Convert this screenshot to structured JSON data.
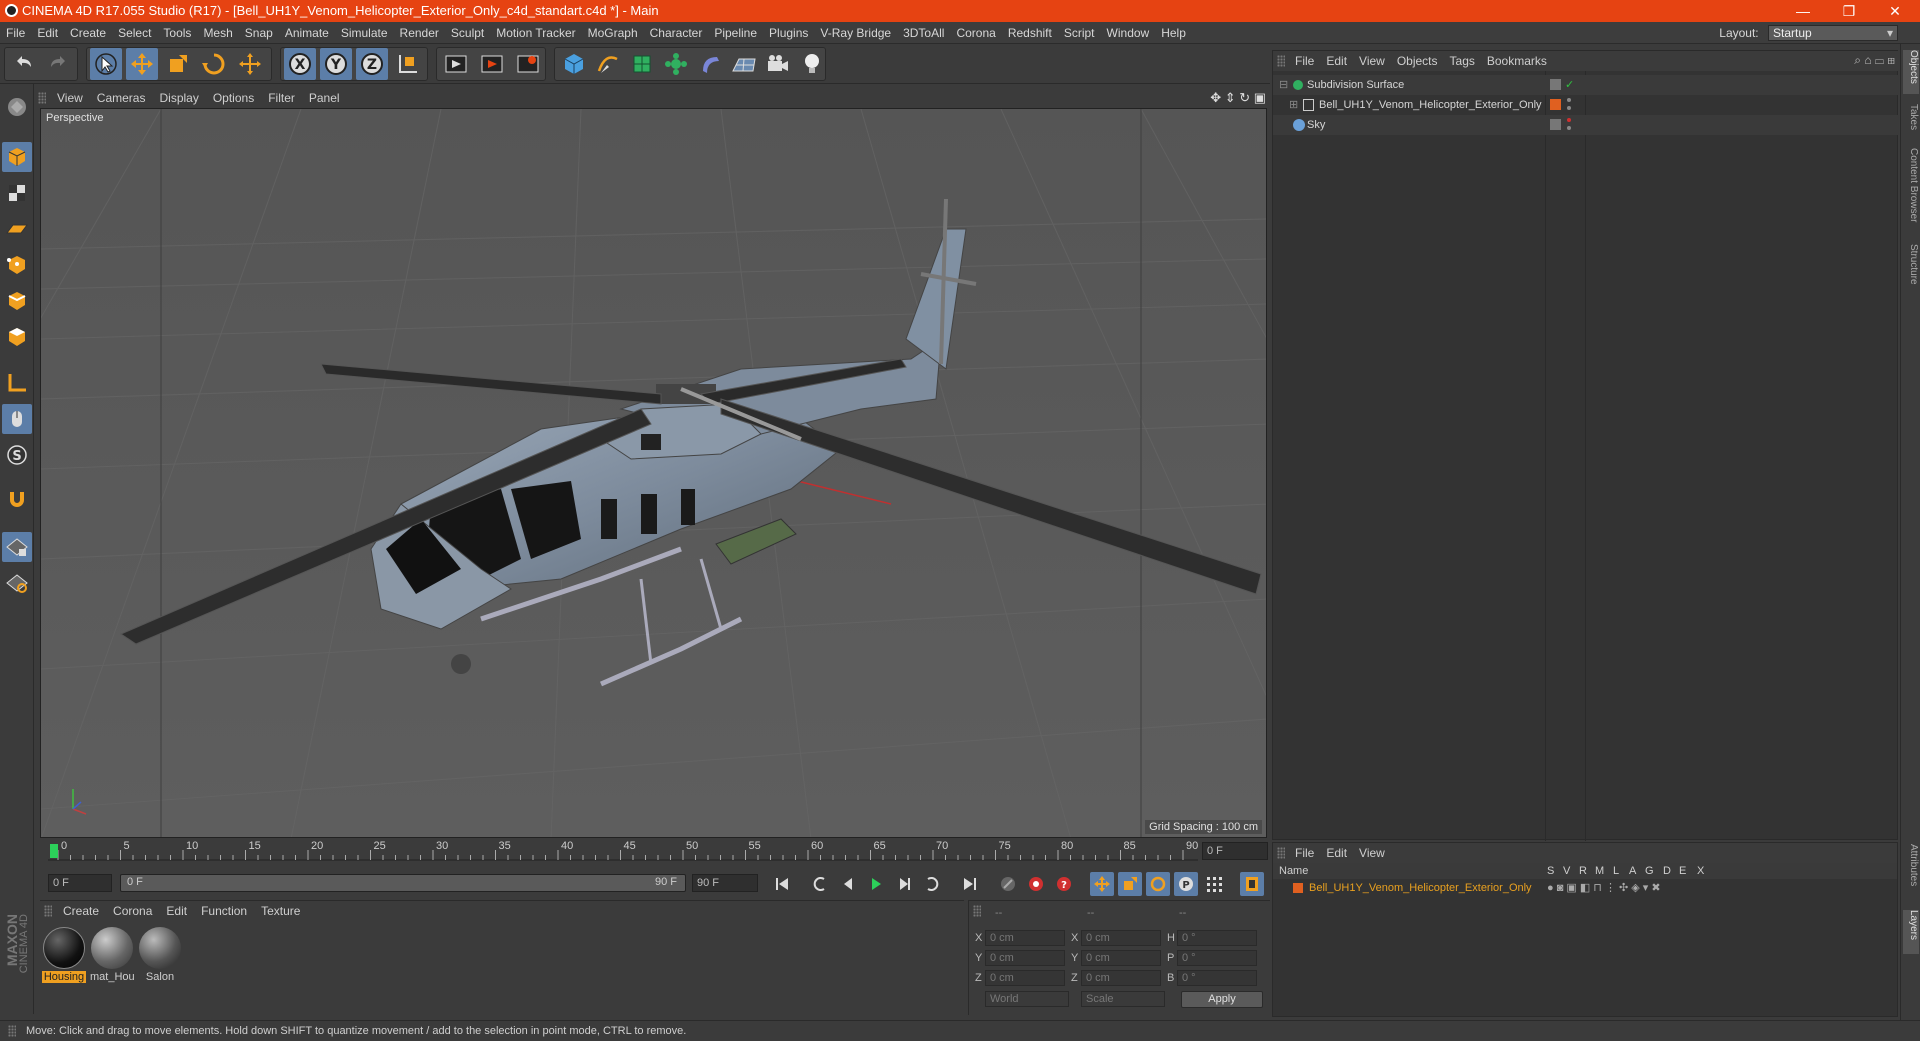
{
  "window": {
    "title": "CINEMA 4D R17.055 Studio (R17) - [Bell_UH1Y_Venom_Helicopter_Exterior_Only_c4d_standart.c4d *] - Main",
    "minimize": "—",
    "maximize": "❐",
    "close": "✕"
  },
  "menubar": {
    "items": [
      "File",
      "Edit",
      "Create",
      "Select",
      "Tools",
      "Mesh",
      "Snap",
      "Animate",
      "Simulate",
      "Render",
      "Sculpt",
      "Motion Tracker",
      "MoGraph",
      "Character",
      "Pipeline",
      "Plugins",
      "V-Ray Bridge",
      "3DToAll",
      "Corona",
      "Redshift",
      "Script",
      "Window",
      "Help"
    ],
    "layout_label": "Layout:",
    "layout_value": "Startup"
  },
  "toolbar": {
    "icons": [
      "undo-icon",
      "redo-icon",
      "select-arrow-icon",
      "move-icon",
      "scale-icon",
      "rotate-icon",
      "transform-icon",
      "x-axis-icon",
      "y-axis-icon",
      "z-axis-icon",
      "coordinate-system-icon",
      "render-view-icon",
      "render-picture-viewer-icon",
      "edit-render-settings-icon",
      "cube-primitive-icon",
      "pen-spline-icon",
      "subdivision-icon",
      "cloner-icon",
      "deformer-icon",
      "floor-icon",
      "camera-icon",
      "light-icon"
    ],
    "x_label": "X",
    "y_label": "Y",
    "z_label": "Z"
  },
  "viewport": {
    "menu": [
      "View",
      "Cameras",
      "Display",
      "Options",
      "Filter",
      "Panel"
    ],
    "label": "Perspective",
    "grid_spacing": "Grid Spacing : 100 cm"
  },
  "timeline": {
    "ticks": [
      "0",
      "5",
      "10",
      "15",
      "20",
      "25",
      "30",
      "35",
      "40",
      "45",
      "50",
      "55",
      "60",
      "65",
      "70",
      "75",
      "80",
      "85",
      "90"
    ],
    "current_frame": "0 F",
    "start_field": "0 F",
    "slider_start": "0 F",
    "slider_end": "90 F",
    "end_field": "90 F"
  },
  "materials": {
    "menu": [
      "Create",
      "Corona",
      "Edit",
      "Function",
      "Texture"
    ],
    "items": [
      {
        "name": "Housing",
        "selected": true
      },
      {
        "name": "mat_Hou",
        "selected": false
      },
      {
        "name": "Salon",
        "selected": false
      }
    ]
  },
  "coordinates": {
    "header": [
      "--",
      "--",
      "--"
    ],
    "rows": [
      {
        "a": "X",
        "av": "0 cm",
        "b": "X",
        "bv": "0 cm",
        "c": "H",
        "cv": "0 °"
      },
      {
        "a": "Y",
        "av": "0 cm",
        "b": "Y",
        "bv": "0 cm",
        "c": "P",
        "cv": "0 °"
      },
      {
        "a": "Z",
        "av": "0 cm",
        "b": "Z",
        "bv": "0 cm",
        "c": "B",
        "cv": "0 °"
      }
    ],
    "mode": "World",
    "type": "Scale",
    "apply": "Apply"
  },
  "objects": {
    "menu": [
      "File",
      "Edit",
      "View",
      "Objects",
      "Tags",
      "Bookmarks"
    ],
    "tree": [
      {
        "name": "Subdivision Surface",
        "indent": 0,
        "color": "#cfcfcf",
        "check": "✓"
      },
      {
        "name": "Bell_UH1Y_Venom_Helicopter_Exterior_Only",
        "indent": 1,
        "color": "#cfcfcf",
        "check": ""
      },
      {
        "name": "Sky",
        "indent": 0,
        "color": "#cfcfcf",
        "check": ""
      }
    ]
  },
  "layers": {
    "menu": [
      "File",
      "Edit",
      "View"
    ],
    "columns": [
      "Name",
      "S",
      "V",
      "R",
      "M",
      "L",
      "A",
      "G",
      "D",
      "E",
      "X"
    ],
    "rows": [
      {
        "name": "Bell_UH1Y_Venom_Helicopter_Exterior_Only",
        "color": "#e8a020"
      }
    ]
  },
  "right_tabs": [
    "Objects",
    "Takes",
    "Content Browser",
    "Structure",
    "Attributes",
    "Layers"
  ],
  "status": "Move: Click and drag to move elements. Hold down SHIFT to quantize movement / add to the selection in point mode, CTRL to remove.",
  "branding": [
    "MAXON",
    "CINEMA 4D"
  ]
}
